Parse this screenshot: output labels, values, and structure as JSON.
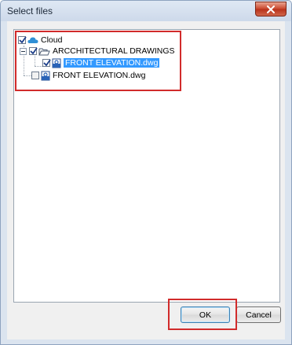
{
  "window": {
    "title": "Select files"
  },
  "tree": {
    "root": {
      "label": "Cloud",
      "checked": true,
      "icon": "cloud-icon"
    },
    "folder": {
      "label": "ARCCHITECTURAL DRAWINGS",
      "checked": true,
      "icon": "folder-open-icon"
    },
    "file_in_folder": {
      "label": "FRONT ELEVATION.dwg",
      "checked": true,
      "selected": true,
      "icon": "dwg-file-icon"
    },
    "file_root": {
      "label": "FRONT ELEVATION.dwg",
      "checked": false,
      "icon": "dwg-file-icon"
    }
  },
  "buttons": {
    "ok_label": "OK",
    "cancel_label": "Cancel"
  },
  "colors": {
    "highlight": "#d12b2b",
    "selection": "#3399ff",
    "close": "#c9452b"
  }
}
